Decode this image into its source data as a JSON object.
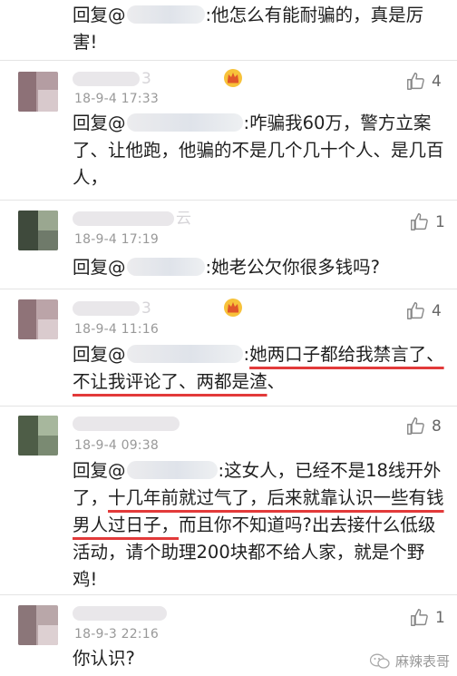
{
  "comments": [
    {
      "id": "c0",
      "reply_prefix": "回复@",
      "reply_text": ":他怎么有能耐骗的，真是厉害!"
    },
    {
      "id": "c1",
      "name_tail": "3",
      "time": "18-9-4 17:33",
      "likes": "4",
      "reply_prefix": "回复@",
      "reply_text": ":咋骗我60万，警方立案了、让他跑，他骗的不是几个几十个人、是几百人，"
    },
    {
      "id": "c2",
      "name_tail": "云",
      "time": "18-9-4 17:19",
      "likes": "1",
      "reply_prefix": "回复@",
      "reply_text": ":她老公欠你很多钱吗?"
    },
    {
      "id": "c3",
      "name_tail": "3",
      "time": "18-9-4 11:16",
      "likes": "4",
      "reply_prefix": "回复@",
      "reply_text_a": ":",
      "reply_text_u1": "她两口子都给我禁言了、不让我评论了、两都是渣",
      "reply_text_b": "、"
    },
    {
      "id": "c4",
      "time": "18-9-4 09:38",
      "likes": "8",
      "reply_prefix": "回复@",
      "reply_text_a": ":这女人，已经不是18线开外了，",
      "reply_text_u1": "十几年前就过气了，后来就靠认识一些有钱男人过日子，",
      "reply_text_b": "而且你不知道吗?出去接什么低级活动，请个助理200块都不给人家，就是个野鸡!"
    },
    {
      "id": "c5",
      "time": "18-9-3 22:16",
      "likes": "1",
      "reply_text": "你认识?"
    }
  ],
  "watermark": "麻辣表哥",
  "icons": {
    "like": "thumbs-up-icon",
    "crown": "crown-badge-icon",
    "watermark": "wechat-logo-icon"
  },
  "colors": {
    "underline": "#e23a3a",
    "meta": "#999999",
    "separator": "#e4e4e4"
  }
}
